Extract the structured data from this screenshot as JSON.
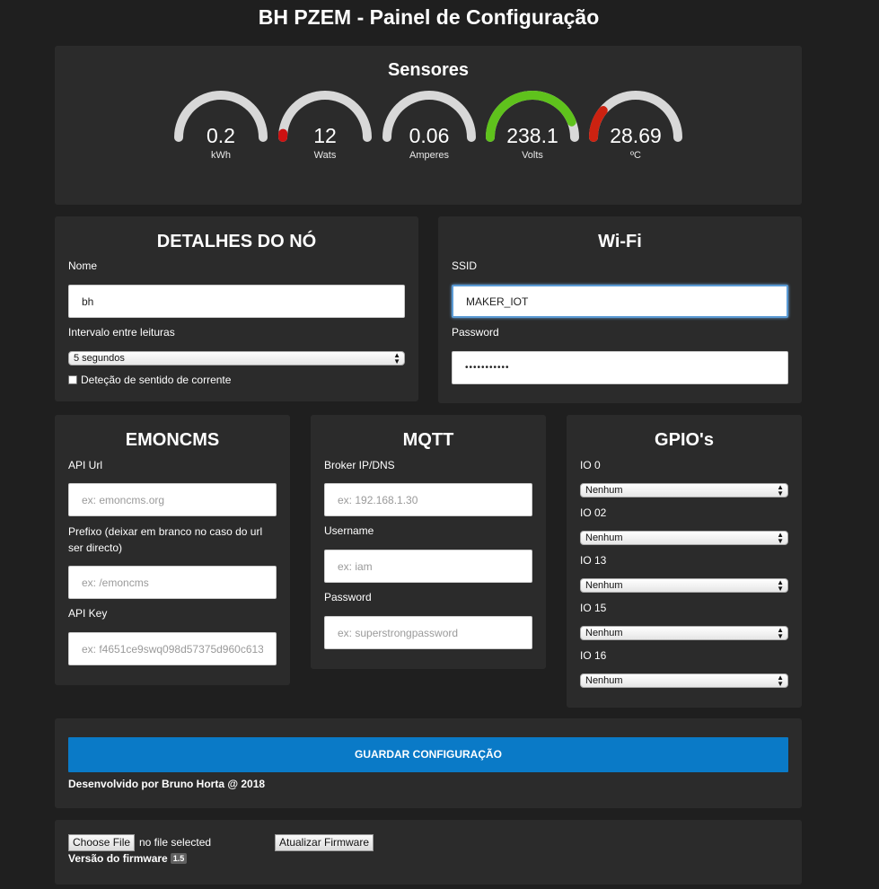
{
  "title": "BH PZEM - Painel de Configuração",
  "sensors": {
    "title": "Sensores",
    "gauges": [
      {
        "value": "0.2",
        "unit": "kWh",
        "fraction": 0.0,
        "color": "#d8d8d8"
      },
      {
        "value": "12",
        "unit": "Wats",
        "fraction": 0.03,
        "color": "#cc1111"
      },
      {
        "value": "0.06",
        "unit": "Amperes",
        "fraction": 0.0,
        "color": "#d8d8d8"
      },
      {
        "value": "238.1",
        "unit": "Volts",
        "fraction": 0.88,
        "color": "#5fc21c"
      },
      {
        "value": "28.69",
        "unit": "ºC",
        "fraction": 0.22,
        "color": "#cc2211"
      }
    ]
  },
  "node": {
    "title": "DETALHES DO NÓ",
    "name_label": "Nome",
    "name_value": "bh",
    "interval_label": "Intervalo entre leituras",
    "interval_value": "5 segundos",
    "direction_label": "Deteção de sentido de corrente"
  },
  "wifi": {
    "title": "Wi-Fi",
    "ssid_label": "SSID",
    "ssid_value": "MAKER_IOT",
    "password_label": "Password",
    "password_value": "•••••••••••"
  },
  "emoncms": {
    "title": "EMONCMS",
    "api_url_label": "API Url",
    "api_url_placeholder": "ex: emoncms.org",
    "prefix_label": "Prefixo (deixar em branco no caso do url ser directo)",
    "prefix_placeholder": "ex: /emoncms",
    "api_key_label": "API Key",
    "api_key_placeholder": "ex: f4651ce9swq098d57375d960c613"
  },
  "mqtt": {
    "title": "MQTT",
    "broker_label": "Broker IP/DNS",
    "broker_placeholder": "ex: 192.168.1.30",
    "username_label": "Username",
    "username_placeholder": "ex: iam",
    "password_label": "Password",
    "password_placeholder": "ex: superstrongpassword"
  },
  "gpio": {
    "title": "GPIO's",
    "items": [
      {
        "label": "IO 0",
        "value": "Nenhum"
      },
      {
        "label": "IO 02",
        "value": "Nenhum"
      },
      {
        "label": "IO 13",
        "value": "Nenhum"
      },
      {
        "label": "IO 15",
        "value": "Nenhum"
      },
      {
        "label": "IO 16",
        "value": "Nenhum"
      }
    ]
  },
  "save": {
    "button_label": "GUARDAR CONFIGURAÇÃO",
    "footer": "Desenvolvido por Bruno Horta @ 2018"
  },
  "firmware": {
    "choose_label": "Choose File",
    "no_file": "no file selected",
    "update_label": "Atualizar Firmware",
    "version_label": "Versão do firmware",
    "version_value": "1.5"
  },
  "colors": {
    "background": "#1f1f1f",
    "panel": "#2b2b2b",
    "accent": "#0a7ac7",
    "gauge_track": "#d8d8d8"
  }
}
